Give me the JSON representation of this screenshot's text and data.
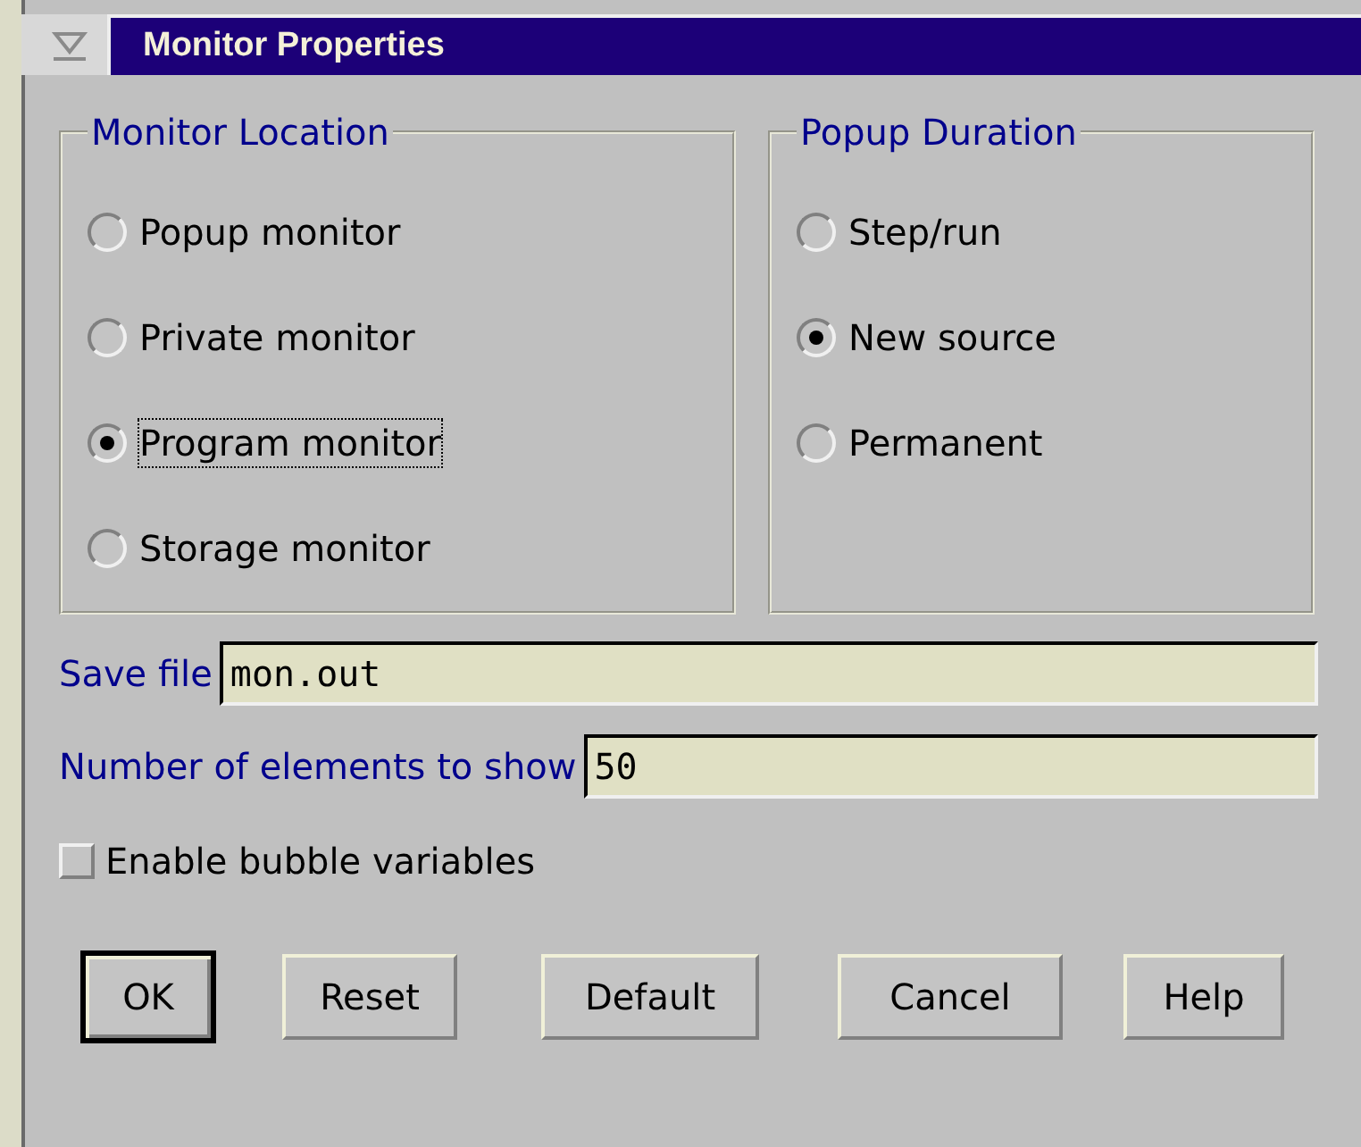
{
  "window": {
    "title": "Monitor Properties"
  },
  "groups": [
    {
      "title": "Monitor Location",
      "options": [
        {
          "label": "Popup monitor",
          "selected": false,
          "focused": false
        },
        {
          "label": "Private monitor",
          "selected": false,
          "focused": false
        },
        {
          "label": "Program monitor",
          "selected": true,
          "focused": true
        },
        {
          "label": "Storage monitor",
          "selected": false,
          "focused": false
        }
      ]
    },
    {
      "title": "Popup Duration",
      "options": [
        {
          "label": "Step/run",
          "selected": false,
          "focused": false
        },
        {
          "label": "New source",
          "selected": true,
          "focused": false
        },
        {
          "label": "Permanent",
          "selected": false,
          "focused": false
        }
      ]
    }
  ],
  "fields": [
    {
      "label": "Save file",
      "value": "mon.out"
    },
    {
      "label": "Number of elements to show",
      "value": "50"
    }
  ],
  "checkbox": {
    "label": "Enable bubble variables",
    "checked": false
  },
  "buttons": [
    {
      "label": "OK",
      "default": true
    },
    {
      "label": "Reset",
      "default": false
    },
    {
      "label": "Default",
      "default": false
    },
    {
      "label": "Cancel",
      "default": false
    },
    {
      "label": "Help",
      "default": false
    }
  ]
}
